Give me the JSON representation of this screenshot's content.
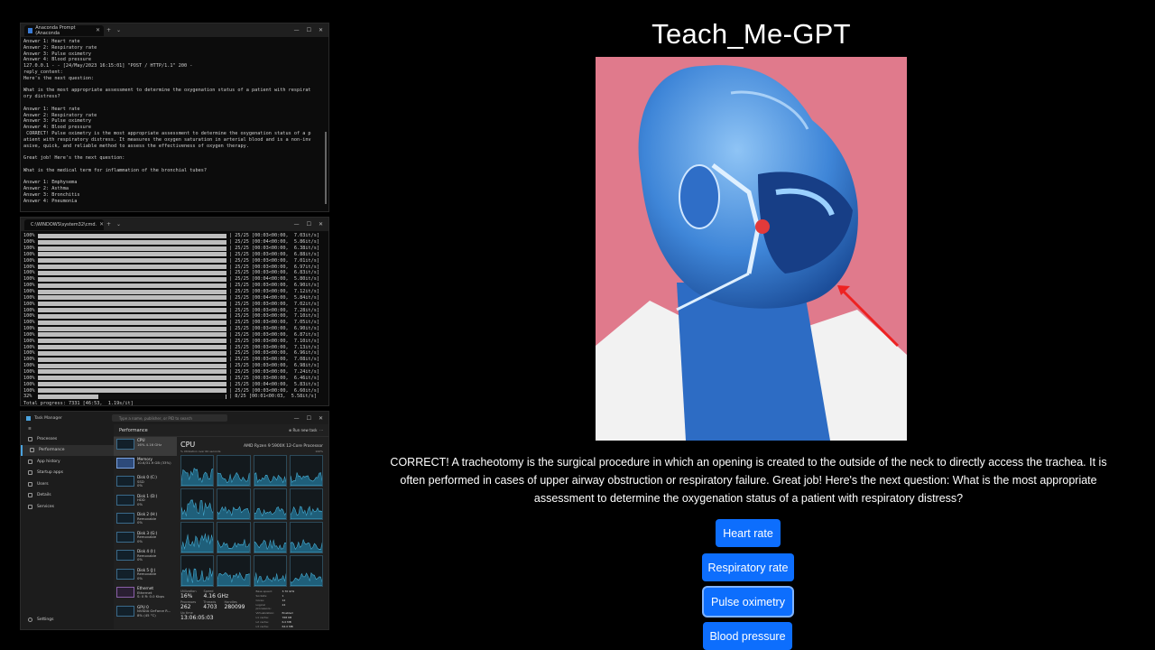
{
  "terminal1": {
    "tab_title": "Anaconda Prompt (Anaconda",
    "lines": [
      "Answer 1: Heart rate",
      "Answer 2: Respiratory rate",
      "Answer 3: Pulse oximetry",
      "Answer 4: Blood pressure",
      "127.0.0.1 - - [24/May/2023 16:15:01] \"POST / HTTP/1.1\" 200 -",
      "reply_content:",
      "Here's the next question:",
      "",
      "What is the most appropriate assessment to determine the oxygenation status of a patient with respirat",
      "ory distress?",
      "",
      "Answer 1: Heart rate",
      "Answer 2: Respiratory rate",
      "Answer 3: Pulse oximetry",
      "Answer 4: Blood pressure",
      " CORRECT! Pulse oximetry is the most appropriate assessment to determine the oxygenation status of a p",
      "atient with respiratory distress. It measures the oxygen saturation in arterial blood and is a non-inv",
      "asive, quick, and reliable method to assess the effectiveness of oxygen therapy.",
      "",
      "Great job! Here's the next question:",
      "",
      "What is the medical term for inflammation of the bronchial tubes?",
      "",
      "Answer 1: Emphysema",
      "Answer 2: Asthma",
      "Answer 3: Bronchitis",
      "Answer 4: Pneumonia"
    ]
  },
  "terminal2": {
    "tab_title": "C:\\WINDOWS\\system32\\cmd.",
    "rows": [
      {
        "pct": "100%",
        "fill": 1.0,
        "stat": "| 25/25 [00:03<00:00,  7.03it/s]"
      },
      {
        "pct": "100%",
        "fill": 1.0,
        "stat": "| 25/25 [00:04<00:00,  5.86it/s]"
      },
      {
        "pct": "100%",
        "fill": 1.0,
        "stat": "| 25/25 [00:03<00:00,  6.38it/s]"
      },
      {
        "pct": "100%",
        "fill": 1.0,
        "stat": "| 25/25 [00:03<00:00,  6.88it/s]"
      },
      {
        "pct": "100%",
        "fill": 1.0,
        "stat": "| 25/25 [00:03<00:00,  7.01it/s]"
      },
      {
        "pct": "100%",
        "fill": 1.0,
        "stat": "| 25/25 [00:03<00:00,  6.97it/s]"
      },
      {
        "pct": "100%",
        "fill": 1.0,
        "stat": "| 25/25 [00:03<00:00,  6.83it/s]"
      },
      {
        "pct": "100%",
        "fill": 1.0,
        "stat": "| 25/25 [00:04<00:00,  5.80it/s]"
      },
      {
        "pct": "100%",
        "fill": 1.0,
        "stat": "| 25/25 [00:03<00:00,  6.90it/s]"
      },
      {
        "pct": "100%",
        "fill": 1.0,
        "stat": "| 25/25 [00:03<00:00,  7.12it/s]"
      },
      {
        "pct": "100%",
        "fill": 1.0,
        "stat": "| 25/25 [00:04<00:00,  5.84it/s]"
      },
      {
        "pct": "100%",
        "fill": 1.0,
        "stat": "| 25/25 [00:03<00:00,  7.02it/s]"
      },
      {
        "pct": "100%",
        "fill": 1.0,
        "stat": "| 25/25 [00:03<00:00,  7.28it/s]"
      },
      {
        "pct": "100%",
        "fill": 1.0,
        "stat": "| 25/25 [00:03<00:00,  7.10it/s]"
      },
      {
        "pct": "100%",
        "fill": 1.0,
        "stat": "| 25/25 [00:03<00:00,  7.05it/s]"
      },
      {
        "pct": "100%",
        "fill": 1.0,
        "stat": "| 25/25 [00:03<00:00,  6.90it/s]"
      },
      {
        "pct": "100%",
        "fill": 1.0,
        "stat": "| 25/25 [00:03<00:00,  6.87it/s]"
      },
      {
        "pct": "100%",
        "fill": 1.0,
        "stat": "| 25/25 [00:03<00:00,  7.10it/s]"
      },
      {
        "pct": "100%",
        "fill": 1.0,
        "stat": "| 25/25 [00:03<00:00,  7.13it/s]"
      },
      {
        "pct": "100%",
        "fill": 1.0,
        "stat": "| 25/25 [00:03<00:00,  6.96it/s]"
      },
      {
        "pct": "100%",
        "fill": 1.0,
        "stat": "| 25/25 [00:03<00:00,  7.08it/s]"
      },
      {
        "pct": "100%",
        "fill": 1.0,
        "stat": "| 25/25 [00:03<00:00,  6.98it/s]"
      },
      {
        "pct": "100%",
        "fill": 1.0,
        "stat": "| 25/25 [00:03<00:00,  7.24it/s]"
      },
      {
        "pct": "100%",
        "fill": 1.0,
        "stat": "| 25/25 [00:03<00:00,  6.46it/s]"
      },
      {
        "pct": "100%",
        "fill": 1.0,
        "stat": "| 25/25 [00:04<00:00,  5.83it/s]"
      },
      {
        "pct": "100%",
        "fill": 1.0,
        "stat": "| 25/25 [00:03<00:00,  6.60it/s]"
      },
      {
        "pct": " 32%",
        "fill": 0.32,
        "stat": "| 8/25 [00:01<00:03,  5.58it/s]"
      }
    ],
    "total": "Total progress: 7331 [46:53,  1.19s/it]"
  },
  "taskmgr": {
    "app_name": "Task Manager",
    "search_placeholder": "Type a name, publisher, or PID to search",
    "nav": [
      "Processes",
      "Performance",
      "App history",
      "Startup apps",
      "Users",
      "Details",
      "Services"
    ],
    "nav_settings": "Settings",
    "header": "Performance",
    "run_task": "Run new task",
    "list": [
      {
        "name": "CPU",
        "sub": "16% 4.16 GHz",
        "style": "normal"
      },
      {
        "name": "Memory",
        "sub": "10.6/31.9 GB (33%)",
        "style": "blue"
      },
      {
        "name": "Disk 0 (C:)",
        "sub": "SSD\n0%",
        "style": "normal"
      },
      {
        "name": "Disk 1 (D:)",
        "sub": "HDD\n0%",
        "style": "normal"
      },
      {
        "name": "Disk 2 (H:)",
        "sub": "Removable\n0%",
        "style": "normal"
      },
      {
        "name": "Disk 3 (G:)",
        "sub": "Removable\n0%",
        "style": "normal"
      },
      {
        "name": "Disk 4 (I:)",
        "sub": "Removable\n0%",
        "style": "normal"
      },
      {
        "name": "Disk 5 (J:)",
        "sub": "Removable\n0%",
        "style": "normal"
      },
      {
        "name": "Ethernet",
        "sub": "Ethernet\nS: 0 R: 0.0 Kbps",
        "style": "purple"
      },
      {
        "name": "GPU 0",
        "sub": "NVIDIA GeForce R...\n8% (45 °C)",
        "style": "normal"
      }
    ],
    "cpu_title": "CPU",
    "cpu_model": "AMD Ryzen 9 5900X 12-Core Processor",
    "cpu_sub_left": "% Utilization over 60 seconds",
    "cpu_sub_right": "100%",
    "stats": {
      "utilization_label": "Utilization",
      "utilization": "16%",
      "speed_label": "Speed",
      "speed": "4.16 GHz",
      "processes_label": "Processes",
      "processes": "262",
      "threads_label": "Threads",
      "threads": "4703",
      "handles_label": "Handles",
      "handles": "280099",
      "uptime_label": "Up time",
      "uptime": "13:06:05:03"
    },
    "specs": [
      [
        "Base speed:",
        "3.70 GHz"
      ],
      [
        "Sockets:",
        "1"
      ],
      [
        "Cores:",
        "12"
      ],
      [
        "Logical processors:",
        "24"
      ],
      [
        "Virtualization:",
        "Enabled"
      ],
      [
        "L1 cache:",
        "768 KB"
      ],
      [
        "L2 cache:",
        "6.0 MB"
      ],
      [
        "L3 cache:",
        "64.0 MB"
      ]
    ]
  },
  "app": {
    "title": "Teach_Me-GPT",
    "message": "CORRECT! A tracheotomy is the surgical procedure in which an opening is created to the outside of the neck to directly access the trachea. It is often performed in cases of upper airway obstruction or respiratory failure. Great job! Here's the next question: What is the most appropriate assessment to determine the oxygenation status of a patient with respiratory distress?",
    "answers": [
      "Heart rate",
      "Respiratory rate",
      "Pulse oximetry",
      "Blood pressure"
    ],
    "accent": "#0d6efd"
  }
}
